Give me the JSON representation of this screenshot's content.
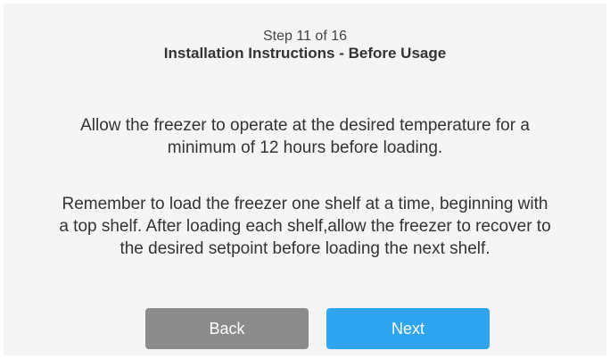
{
  "header": {
    "step": "Step 11 of 16",
    "title": "Installation Instructions - Before Usage"
  },
  "content": {
    "paragraph1": "Allow the freezer to operate at the desired temperature for a minimum of 12 hours before loading.",
    "paragraph2": "Remember to load the freezer one shelf at a time, beginning with a top shelf. After loading each shelf,allow the freezer to recover to the desired setpoint before loading the next shelf."
  },
  "buttons": {
    "back": "Back",
    "next": "Next"
  },
  "colors": {
    "background": "#f5f5f5",
    "back_button": "#8b8b8b",
    "next_button": "#2ea5ee"
  }
}
